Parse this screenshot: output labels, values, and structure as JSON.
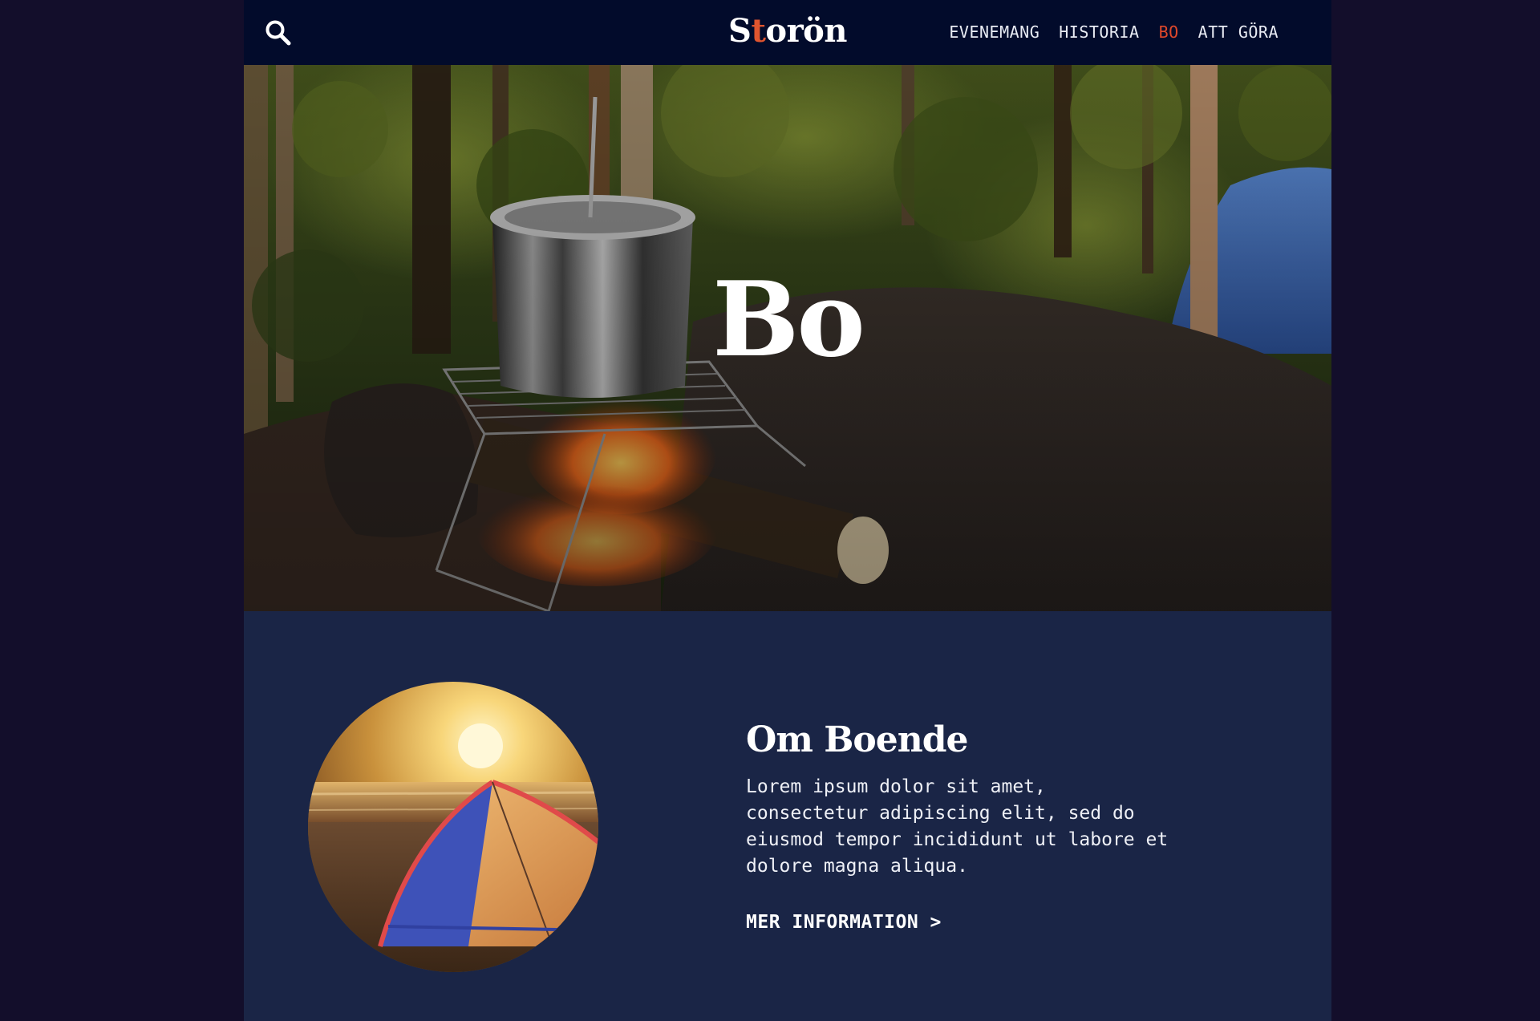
{
  "header": {
    "logo_before": "S",
    "logo_accent": "t",
    "logo_after": "orön",
    "search_icon": "search-icon",
    "nav": [
      {
        "label": "EVENEMANG",
        "active": false
      },
      {
        "label": "HISTORIA",
        "active": false
      },
      {
        "label": "BO",
        "active": true
      },
      {
        "label": "ATT GÖRA",
        "active": false
      }
    ]
  },
  "hero": {
    "title": "Bo",
    "image": "campfire-cooking-pot-photo"
  },
  "about": {
    "image": "tent-at-sunset-photo",
    "heading": "Om Boende",
    "body": "Lorem ipsum dolor sit amet, consectetur adipiscing elit, sed do eiusmod tempor incididunt ut labore et dolore magna aliqua.",
    "link": "MER INFORMATION >"
  },
  "colors": {
    "outer_background": "#130e2b",
    "header_background": "#020b2b",
    "section_background": "#1a2546",
    "accent": "#e0482b",
    "text": "#ffffff"
  }
}
